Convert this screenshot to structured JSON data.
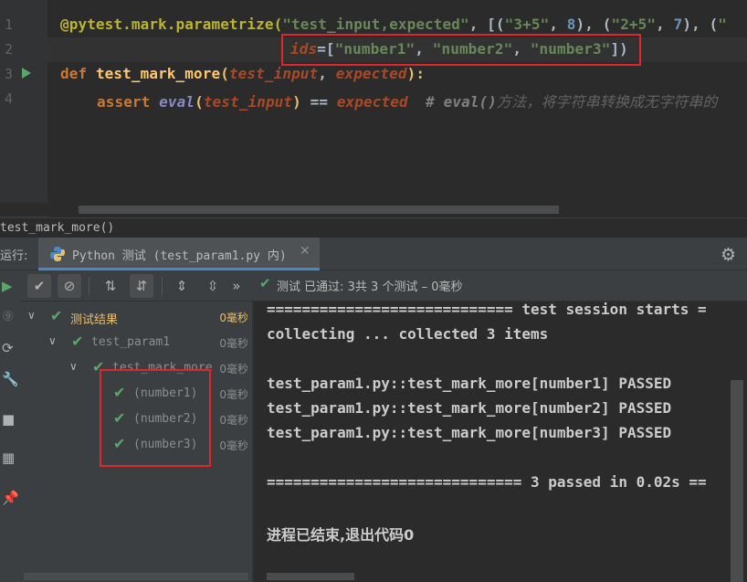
{
  "editor": {
    "line_numbers": [
      "1",
      "2",
      "3",
      "4"
    ],
    "line1": {
      "decorator": "@pytest.mark.parametrize(",
      "arg1": "\"test_input,expected\"",
      "comma1": ", [(",
      "s1": "\"3+5\"",
      "c1": ", ",
      "n1": "8",
      "p1": "), (",
      "s2": "\"2+5\"",
      "c2": ", ",
      "n2": "7",
      "p2": "), (",
      "s3": "\""
    },
    "line2": {
      "ids_kw": "ids",
      "eq": "=[",
      "id1": "\"number1\"",
      "c1": ", ",
      "id2": "\"number2\"",
      "c2": ", ",
      "id3": "\"number3\"",
      "end": "])"
    },
    "line3": {
      "def_kw": "def ",
      "func": "test_mark_more",
      "open": "(",
      "param1": "test_input",
      "comma": ", ",
      "param2": "expected",
      "close": "):"
    },
    "line4": {
      "assert_kw": "assert ",
      "eval": "eval",
      "open": "(",
      "arg": "test_input",
      "close": ")",
      "op": " == ",
      "rhs": "expected",
      "comment": "  # eval()",
      "comment_cjk": "方法，将字符串转换成无字符串的"
    }
  },
  "breadcrumb": "test_mark_more()",
  "run_window": {
    "label": "运行:",
    "tab_label": "Python 测试 (test_param1.py 内)",
    "status": "测试 已通过: 3共 3 个测试 – 0毫秒"
  },
  "tree": {
    "root": {
      "label": "测试结果",
      "time": "0毫秒"
    },
    "module": {
      "label": "test_param1",
      "time": "0毫秒"
    },
    "func": {
      "label": "test_mark_more",
      "time": "0毫秒"
    },
    "cases": [
      {
        "label": "(number1)",
        "time": "0毫秒"
      },
      {
        "label": "(number2)",
        "time": "0毫秒"
      },
      {
        "label": "(number3)",
        "time": "0毫秒"
      }
    ]
  },
  "console": {
    "lines": [
      "============================ test session starts =",
      "collecting ... collected 3 items",
      "",
      "test_param1.py::test_mark_more[number1] PASSED",
      "test_param1.py::test_mark_more[number2] PASSED",
      "test_param1.py::test_mark_more[number3] PASSED",
      "",
      "============================= 3 passed in 0.02s ==",
      "",
      "进程已结束,退出代码0"
    ]
  },
  "colors": {
    "pass_green": "#59a869",
    "highlight_red": "#e0262b",
    "tab_accent": "#4a88c7"
  }
}
